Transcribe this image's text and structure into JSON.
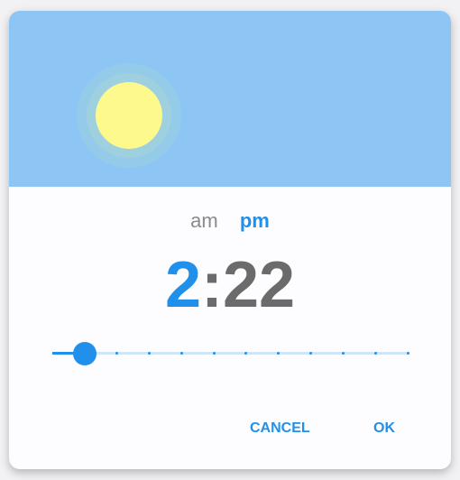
{
  "header": {
    "icon": "sun-icon",
    "sky_color": "#8dc6f5",
    "sun_color": "#fdf98d"
  },
  "period": {
    "am_label": "am",
    "pm_label": "pm",
    "selected": "pm"
  },
  "time": {
    "hour": "2",
    "separator": ":",
    "minute": "22"
  },
  "slider": {
    "steps": 11,
    "value": 1
  },
  "actions": {
    "cancel_label": "CANCEL",
    "ok_label": "OK"
  },
  "colors": {
    "accent": "#2190ea",
    "muted": "#6b6b6b"
  }
}
